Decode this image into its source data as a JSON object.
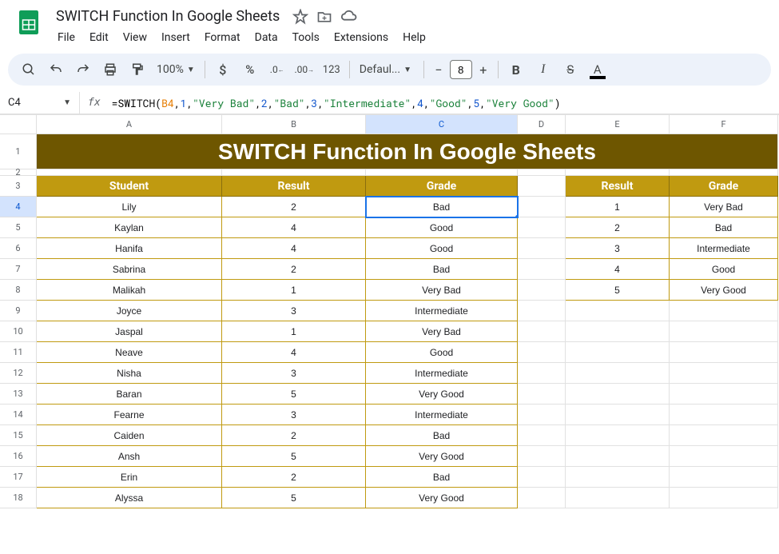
{
  "doc_title": "SWITCH Function In Google Sheets",
  "menubar": [
    "File",
    "Edit",
    "View",
    "Insert",
    "Format",
    "Data",
    "Tools",
    "Extensions",
    "Help"
  ],
  "toolbar": {
    "zoom": "100%",
    "font": "Defaul...",
    "font_size": "8"
  },
  "name_box": "C4",
  "formula": {
    "fn": "SWITCH",
    "ref": "B4",
    "pairs": [
      {
        "n": "1",
        "s": "\"Very Bad\""
      },
      {
        "n": "2",
        "s": "\"Bad\""
      },
      {
        "n": "3",
        "s": "\"Intermediate\""
      },
      {
        "n": "4",
        "s": "\"Good\""
      },
      {
        "n": "5",
        "s": "\"Very Good\""
      }
    ]
  },
  "columns": [
    "A",
    "B",
    "C",
    "D",
    "E",
    "F"
  ],
  "selected_col": "C",
  "selected_row": 4,
  "sheet_title": "SWITCH Function In Google Sheets",
  "main_headers": [
    "Student",
    "Result",
    "Grade"
  ],
  "lookup_headers": [
    "Result",
    "Grade"
  ],
  "students": [
    {
      "name": "Lily",
      "result": "2",
      "grade": "Bad"
    },
    {
      "name": "Kaylan",
      "result": "4",
      "grade": "Good"
    },
    {
      "name": "Hanifa",
      "result": "4",
      "grade": "Good"
    },
    {
      "name": "Sabrina",
      "result": "2",
      "grade": "Bad"
    },
    {
      "name": "Malikah",
      "result": "1",
      "grade": "Very Bad"
    },
    {
      "name": "Joyce",
      "result": "3",
      "grade": "Intermediate"
    },
    {
      "name": "Jaspal",
      "result": "1",
      "grade": "Very Bad"
    },
    {
      "name": "Neave",
      "result": "4",
      "grade": "Good"
    },
    {
      "name": "Nisha",
      "result": "3",
      "grade": "Intermediate"
    },
    {
      "name": "Baran",
      "result": "5",
      "grade": "Very Good"
    },
    {
      "name": "Fearne",
      "result": "3",
      "grade": "Intermediate"
    },
    {
      "name": "Caiden",
      "result": "2",
      "grade": "Bad"
    },
    {
      "name": "Ansh",
      "result": "5",
      "grade": "Very Good"
    },
    {
      "name": "Erin",
      "result": "2",
      "grade": "Bad"
    },
    {
      "name": "Alyssa",
      "result": "5",
      "grade": "Very Good"
    }
  ],
  "lookup": [
    {
      "result": "1",
      "grade": "Very Bad"
    },
    {
      "result": "2",
      "grade": "Bad"
    },
    {
      "result": "3",
      "grade": "Intermediate"
    },
    {
      "result": "4",
      "grade": "Good"
    },
    {
      "result": "5",
      "grade": "Very Good"
    }
  ],
  "row_heights": {
    "1": 44,
    "2": 8,
    "default": 26
  }
}
